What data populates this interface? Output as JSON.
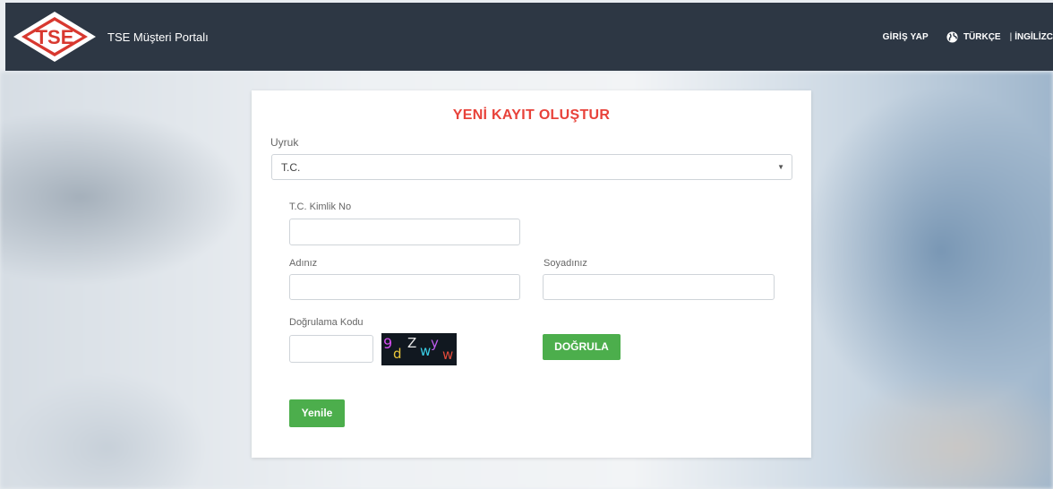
{
  "navbar": {
    "logo_text": "TSE",
    "title": "TSE Müşteri Portalı",
    "login_label": "GİRİŞ YAP",
    "language_label": "TÜRKÇE",
    "separator": "|",
    "english_label": "İNGİLİZC"
  },
  "form": {
    "title": "YENİ KAYIT OLUŞTUR",
    "nationality_label": "Uyruk",
    "nationality_value": "T.C.",
    "id_label": "T.C. Kimlik No",
    "id_value": "",
    "first_name_label": "Adınız",
    "first_name_value": "",
    "last_name_label": "Soyadınız",
    "last_name_value": "",
    "captcha_label": "Doğrulama Kodu",
    "captcha_value": "",
    "captcha_chars": [
      "9",
      "d",
      "Z",
      "w",
      "y",
      "w"
    ],
    "captcha_colors": [
      "#d44cf0",
      "#e9c63a",
      "#e8e8e8",
      "#3ad0e8",
      "#c05cf0",
      "#e24a3a"
    ],
    "verify_button": "DOĞRULA",
    "refresh_button": "Yenile"
  },
  "colors": {
    "navbar_bg": "#2d3744",
    "title_red": "#e8423a",
    "button_green": "#4cae4c"
  }
}
